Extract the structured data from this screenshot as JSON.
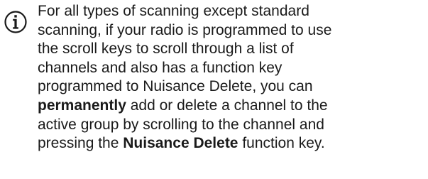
{
  "note": {
    "icon": "info-icon",
    "lines": [
      [
        {
          "text": "For all types of scanning except standard"
        }
      ],
      [
        {
          "text": "scanning, if your radio is programmed to use"
        }
      ],
      [
        {
          "text": "the scroll keys to scroll through a list of"
        }
      ],
      [
        {
          "text": "channels and also has a function key"
        }
      ],
      [
        {
          "text": "programmed to Nuisance Delete, you can"
        }
      ],
      [
        {
          "text": "permanently",
          "bold": true
        },
        {
          "text": " add or delete a channel to the"
        }
      ],
      [
        {
          "text": "active group by scrolling to the channel and"
        }
      ],
      [
        {
          "text": "pressing the "
        },
        {
          "text": "Nuisance Delete",
          "bold": true
        },
        {
          "text": " function key."
        }
      ]
    ]
  }
}
